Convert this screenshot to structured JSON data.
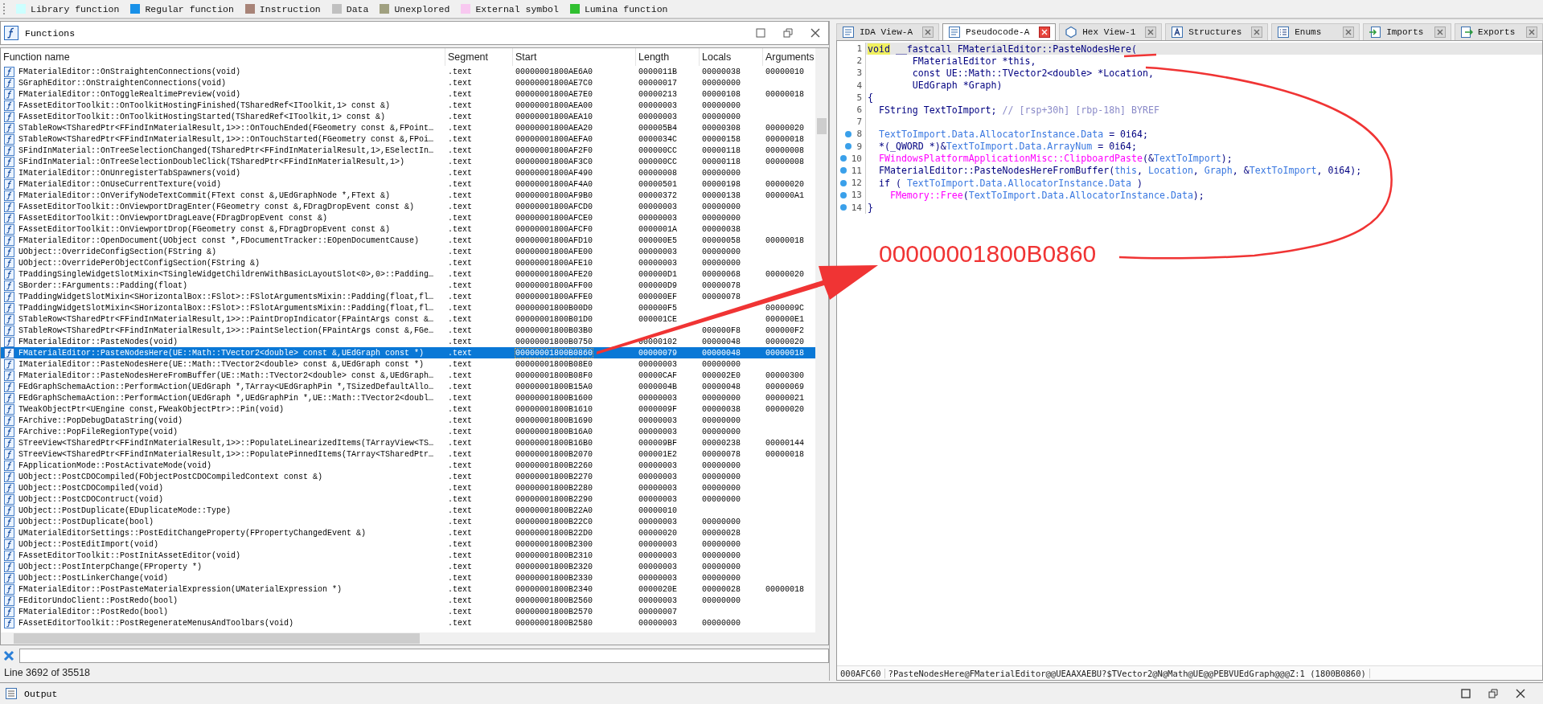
{
  "legend": [
    {
      "label": "Library function",
      "color": "#ccffff"
    },
    {
      "label": "Regular function",
      "color": "#1890e8"
    },
    {
      "label": "Instruction",
      "color": "#a88478"
    },
    {
      "label": "Data",
      "color": "#c0c0c0"
    },
    {
      "label": "Unexplored",
      "color": "#a0a080"
    },
    {
      "label": "External symbol",
      "color": "#f8c8f0"
    },
    {
      "label": "Lumina function",
      "color": "#30c030"
    }
  ],
  "functions_window": {
    "title": "Functions",
    "columns": [
      "Function name",
      "Segment",
      "Start",
      "Length",
      "Locals",
      "Arguments"
    ],
    "rows": [
      {
        "name": "FMaterialEditor::OnStraightenConnections(void)",
        "segment": ".text",
        "start": "00000001800AE6A0",
        "length": "0000011B",
        "locals": "00000038",
        "arguments": "00000010",
        "selected": false
      },
      {
        "name": "SGraphEditor::OnStraightenConnections(void)",
        "segment": ".text",
        "start": "00000001800AE7C0",
        "length": "00000017",
        "locals": "00000000",
        "selected": false
      },
      {
        "name": "FMaterialEditor::OnToggleRealtimePreview(void)",
        "segment": ".text",
        "start": "00000001800AE7E0",
        "length": "00000213",
        "locals": "00000108",
        "arguments": "00000018",
        "selected": false
      },
      {
        "name": "FAssetEditorToolkit::OnToolkitHostingFinished(TSharedRef<IToolkit,1> const &)",
        "segment": ".text",
        "start": "00000001800AEA00",
        "length": "00000003",
        "locals": "00000000",
        "selected": false
      },
      {
        "name": "FAssetEditorToolkit::OnToolkitHostingStarted(TSharedRef<IToolkit,1> const &)",
        "segment": ".text",
        "start": "00000001800AEA10",
        "length": "00000003",
        "locals": "00000000",
        "selected": false
      },
      {
        "name": "STableRow<TSharedPtr<FFindInMaterialResult,1>>::OnTouchEnded(FGeometry const &,FPoint…",
        "segment": ".text",
        "start": "00000001800AEA20",
        "length": "000005B4",
        "locals": "00000308",
        "arguments": "00000020",
        "selected": false
      },
      {
        "name": "STableRow<TSharedPtr<FFindInMaterialResult,1>>::OnTouchStarted(FGeometry const &,FPoi…",
        "segment": ".text",
        "start": "00000001800AEFA0",
        "length": "0000034C",
        "locals": "00000158",
        "arguments": "00000018",
        "selected": false
      },
      {
        "name": "SFindInMaterial::OnTreeSelectionChanged(TSharedPtr<FFindInMaterialResult,1>,ESelectIn…",
        "segment": ".text",
        "start": "00000001800AF2F0",
        "length": "000000CC",
        "locals": "00000118",
        "arguments": "00000008",
        "selected": false
      },
      {
        "name": "SFindInMaterial::OnTreeSelectionDoubleClick(TSharedPtr<FFindInMaterialResult,1>)",
        "segment": ".text",
        "start": "00000001800AF3C0",
        "length": "000000CC",
        "locals": "00000118",
        "arguments": "00000008",
        "selected": false
      },
      {
        "name": "IMaterialEditor::OnUnregisterTabSpawners(void)",
        "segment": ".text",
        "start": "00000001800AF490",
        "length": "00000008",
        "locals": "00000000",
        "selected": false
      },
      {
        "name": "FMaterialEditor::OnUseCurrentTexture(void)",
        "segment": ".text",
        "start": "00000001800AF4A0",
        "length": "00000501",
        "locals": "00000198",
        "arguments": "00000020",
        "selected": false
      },
      {
        "name": "FMaterialEditor::OnVerifyNodeTextCommit(FText const &,UEdGraphNode *,FText &)",
        "segment": ".text",
        "start": "00000001800AF9B0",
        "length": "00000372",
        "locals": "00000138",
        "arguments": "000000A1",
        "selected": false
      },
      {
        "name": "FAssetEditorToolkit::OnViewportDragEnter(FGeometry const &,FDragDropEvent const &)",
        "segment": ".text",
        "start": "00000001800AFCD0",
        "length": "00000003",
        "locals": "00000000",
        "selected": false
      },
      {
        "name": "FAssetEditorToolkit::OnViewportDragLeave(FDragDropEvent const &)",
        "segment": ".text",
        "start": "00000001800AFCE0",
        "length": "00000003",
        "locals": "00000000",
        "selected": false
      },
      {
        "name": "FAssetEditorToolkit::OnViewportDrop(FGeometry const &,FDragDropEvent const &)",
        "segment": ".text",
        "start": "00000001800AFCF0",
        "length": "0000001A",
        "locals": "00000038",
        "selected": false
      },
      {
        "name": "FMaterialEditor::OpenDocument(UObject const *,FDocumentTracker::EOpenDocumentCause)",
        "segment": ".text",
        "start": "00000001800AFD10",
        "length": "000000E5",
        "locals": "00000058",
        "arguments": "00000018",
        "selected": false
      },
      {
        "name": "UObject::OverrideConfigSection(FString &)",
        "segment": ".text",
        "start": "00000001800AFE00",
        "length": "00000003",
        "locals": "00000000",
        "selected": false
      },
      {
        "name": "UObject::OverridePerObjectConfigSection(FString &)",
        "segment": ".text",
        "start": "00000001800AFE10",
        "length": "00000003",
        "locals": "00000000",
        "selected": false
      },
      {
        "name": "TPaddingSingleWidgetSlotMixin<TSingleWidgetChildrenWithBasicLayoutSlot<0>,0>::Padding…",
        "segment": ".text",
        "start": "00000001800AFE20",
        "length": "000000D1",
        "locals": "00000068",
        "arguments": "00000020",
        "selected": false
      },
      {
        "name": "SBorder::FArguments::Padding(float)",
        "segment": ".text",
        "start": "00000001800AFF00",
        "length": "000000D9",
        "locals": "00000078",
        "selected": false
      },
      {
        "name": "TPaddingWidgetSlotMixin<SHorizontalBox::FSlot>::FSlotArgumentsMixin::Padding(float,fl…",
        "segment": ".text",
        "start": "00000001800AFFE0",
        "length": "000000EF",
        "locals": "00000078",
        "selected": false
      },
      {
        "name": "TPaddingWidgetSlotMixin<SHorizontalBox::FSlot>::FSlotArgumentsMixin::Padding(float,fl…",
        "segment": ".text",
        "start": "00000001800B00D0",
        "length": "000000F5",
        "arguments": "0000009C",
        "selected": false
      },
      {
        "name": "STableRow<TSharedPtr<FFindInMaterialResult,1>>::PaintDropIndicator(FPaintArgs const &…",
        "segment": ".text",
        "start": "00000001800B01D0",
        "length": "000001CE",
        "arguments": "000000E1",
        "selected": false
      },
      {
        "name": "STableRow<TSharedPtr<FFindInMaterialResult,1>>::PaintSelection(FPaintArgs const &,FGe…",
        "segment": ".text",
        "start": "00000001800B03B0",
        "locals": "000000F8",
        "arguments": "000000F2",
        "selected": false
      },
      {
        "name": "FMaterialEditor::PasteNodes(void)",
        "segment": ".text",
        "start": "00000001800B0750",
        "length": "00000102",
        "locals": "00000048",
        "arguments": "00000020",
        "selected": false
      },
      {
        "name": "FMaterialEditor::PasteNodesHere(UE::Math::TVector2<double> const &,UEdGraph const *)",
        "segment": ".text",
        "start": "00000001800B0860",
        "length": "00000079",
        "locals": "00000048",
        "arguments": "00000018",
        "selected": true
      },
      {
        "name": "IMaterialEditor::PasteNodesHere(UE::Math::TVector2<double> const &,UEdGraph const *)",
        "segment": ".text",
        "start": "00000001800B08E0",
        "length": "00000003",
        "locals": "00000000",
        "selected": false
      },
      {
        "name": "FMaterialEditor::PasteNodesHereFromBuffer(UE::Math::TVector2<double> const &,UEdGraph…",
        "segment": ".text",
        "start": "00000001800B08F0",
        "length": "00000CAF",
        "locals": "000002E0",
        "arguments": "00000300",
        "selected": false
      },
      {
        "name": "FEdGraphSchemaAction::PerformAction(UEdGraph *,TArray<UEdGraphPin *,TSizedDefaultAllo…",
        "segment": ".text",
        "start": "00000001800B15A0",
        "length": "0000004B",
        "locals": "00000048",
        "arguments": "00000069",
        "selected": false
      },
      {
        "name": "FEdGraphSchemaAction::PerformAction(UEdGraph *,UEdGraphPin *,UE::Math::TVector2<doubl…",
        "segment": ".text",
        "start": "00000001800B1600",
        "length": "00000003",
        "locals": "00000000",
        "arguments": "00000021",
        "selected": false
      },
      {
        "name": "TWeakObjectPtr<UEngine const,FWeakObjectPtr>::Pin(void)",
        "segment": ".text",
        "start": "00000001800B1610",
        "length": "0000009F",
        "locals": "00000038",
        "arguments": "00000020",
        "selected": false
      },
      {
        "name": "FArchive::PopDebugDataString(void)",
        "segment": ".text",
        "start": "00000001800B1690",
        "length": "00000003",
        "locals": "00000000",
        "selected": false
      },
      {
        "name": "FArchive::PopFileRegionType(void)",
        "segment": ".text",
        "start": "00000001800B16A0",
        "length": "00000003",
        "locals": "00000000",
        "selected": false
      },
      {
        "name": "STreeView<TSharedPtr<FFindInMaterialResult,1>>::PopulateLinearizedItems(TArrayView<TS…",
        "segment": ".text",
        "start": "00000001800B16B0",
        "length": "000009BF",
        "locals": "00000238",
        "arguments": "00000144",
        "selected": false
      },
      {
        "name": "STreeView<TSharedPtr<FFindInMaterialResult,1>>::PopulatePinnedItems(TArray<TSharedPtr…",
        "segment": ".text",
        "start": "00000001800B2070",
        "length": "000001E2",
        "locals": "00000078",
        "arguments": "00000018",
        "selected": false
      },
      {
        "name": "FApplicationMode::PostActivateMode(void)",
        "segment": ".text",
        "start": "00000001800B2260",
        "length": "00000003",
        "locals": "00000000",
        "selected": false
      },
      {
        "name": "UObject::PostCDOCompiled(FObjectPostCDOCompiledContext const &)",
        "segment": ".text",
        "start": "00000001800B2270",
        "length": "00000003",
        "locals": "00000000",
        "selected": false
      },
      {
        "name": "UObject::PostCDOCompiled(void)",
        "segment": ".text",
        "start": "00000001800B2280",
        "length": "00000003",
        "locals": "00000000",
        "selected": false
      },
      {
        "name": "UObject::PostCDOContruct(void)",
        "segment": ".text",
        "start": "00000001800B2290",
        "length": "00000003",
        "locals": "00000000",
        "selected": false
      },
      {
        "name": "UObject::PostDuplicate(EDuplicateMode::Type)",
        "segment": ".text",
        "start": "00000001800B22A0",
        "length": "00000010",
        "selected": false
      },
      {
        "name": "UObject::PostDuplicate(bool)",
        "segment": ".text",
        "start": "00000001800B22C0",
        "length": "00000003",
        "locals": "00000000",
        "selected": false
      },
      {
        "name": "UMaterialEditorSettings::PostEditChangeProperty(FPropertyChangedEvent &)",
        "segment": ".text",
        "start": "00000001800B22D0",
        "length": "00000020",
        "locals": "00000028",
        "selected": false
      },
      {
        "name": "UObject::PostEditImport(void)",
        "segment": ".text",
        "start": "00000001800B2300",
        "length": "00000003",
        "locals": "00000000",
        "selected": false
      },
      {
        "name": "FAssetEditorToolkit::PostInitAssetEditor(void)",
        "segment": ".text",
        "start": "00000001800B2310",
        "length": "00000003",
        "locals": "00000000",
        "selected": false
      },
      {
        "name": "UObject::PostInterpChange(FProperty *)",
        "segment": ".text",
        "start": "00000001800B2320",
        "length": "00000003",
        "locals": "00000000",
        "selected": false
      },
      {
        "name": "UObject::PostLinkerChange(void)",
        "segment": ".text",
        "start": "00000001800B2330",
        "length": "00000003",
        "locals": "00000000",
        "selected": false
      },
      {
        "name": "FMaterialEditor::PostPasteMaterialExpression(UMaterialExpression *)",
        "segment": ".text",
        "start": "00000001800B2340",
        "length": "0000020E",
        "locals": "00000028",
        "arguments": "00000018",
        "selected": false
      },
      {
        "name": "FEditorUndoClient::PostRedo(bool)",
        "segment": ".text",
        "start": "00000001800B2560",
        "length": "00000003",
        "locals": "00000000",
        "selected": false
      },
      {
        "name": "FMaterialEditor::PostRedo(bool)",
        "segment": ".text",
        "start": "00000001800B2570",
        "length": "00000007",
        "selected": false
      },
      {
        "name": "FAssetEditorToolkit::PostRegenerateMenusAndToolbars(void)",
        "segment": ".text",
        "start": "00000001800B2580",
        "length": "00000003",
        "locals": "00000000",
        "selected": false
      }
    ],
    "status": "Line 3692 of 35518"
  },
  "tabs": [
    {
      "label": "IDA View-A",
      "kind": "disasm",
      "selected": false
    },
    {
      "label": "Pseudocode-A",
      "kind": "pseudocode",
      "selected": true
    },
    {
      "label": "Hex View-1",
      "kind": "hex",
      "selected": false
    },
    {
      "label": "Structures",
      "kind": "structures",
      "selected": false
    },
    {
      "label": "Enums",
      "kind": "enums",
      "selected": false
    },
    {
      "label": "Imports",
      "kind": "imports",
      "selected": false
    },
    {
      "label": "Exports",
      "kind": "exports",
      "selected": false
    }
  ],
  "code": [
    {
      "number": "1",
      "current": true,
      "breakpoint": false,
      "segments": [
        {
          "text": "void",
          "kind": "match"
        },
        {
          "text": " __fastcall FMaterialEditor::PasteNodesHere(",
          "kind": "plain"
        }
      ]
    },
    {
      "number": "2",
      "current": false,
      "breakpoint": false,
      "segments": [
        {
          "text": "        FMaterialEditor *this,",
          "kind": "plain"
        }
      ]
    },
    {
      "number": "3",
      "current": false,
      "breakpoint": false,
      "segments": [
        {
          "text": "        const UE::Math::TVector2<double> *Location,",
          "kind": "plain"
        }
      ]
    },
    {
      "number": "4",
      "current": false,
      "breakpoint": false,
      "segments": [
        {
          "text": "        UEdGraph *Graph)",
          "kind": "plain"
        }
      ]
    },
    {
      "number": "5",
      "current": false,
      "breakpoint": false,
      "segments": [
        {
          "text": "{",
          "kind": "plain"
        }
      ]
    },
    {
      "number": "6",
      "current": false,
      "breakpoint": false,
      "segments": [
        {
          "text": "  FString TextToImport; ",
          "kind": "plain"
        },
        {
          "text": "// [rsp+30h] [rbp-18h] BYREF",
          "kind": "comment"
        }
      ]
    },
    {
      "number": "7",
      "current": false,
      "breakpoint": false
    },
    {
      "number": "8",
      "current": false,
      "breakpoint": true,
      "segments": [
        {
          "text": "  TextToImport.Data.AllocatorInstance.Data",
          "kind": "var"
        },
        {
          "text": " = 0i64;",
          "kind": "plain"
        }
      ]
    },
    {
      "number": "9",
      "current": false,
      "breakpoint": true,
      "segments": [
        {
          "text": "  *(_QWORD *)&",
          "kind": "plain"
        },
        {
          "text": "TextToImport.Data.ArrayNum",
          "kind": "var"
        },
        {
          "text": " = 0i64;",
          "kind": "plain"
        }
      ]
    },
    {
      "number": "10",
      "current": false,
      "breakpoint": true,
      "segments": [
        {
          "text": "  FWindowsPlatformApplicationMisc::ClipboardPaste",
          "kind": "import"
        },
        {
          "text": "(&",
          "kind": "plain"
        },
        {
          "text": "TextToImport",
          "kind": "var"
        },
        {
          "text": ");",
          "kind": "plain"
        }
      ]
    },
    {
      "number": "11",
      "current": false,
      "breakpoint": true,
      "segments": [
        {
          "text": "  FMaterialEditor::PasteNodesHereFromBuffer(",
          "kind": "plain"
        },
        {
          "text": "this",
          "kind": "var"
        },
        {
          "text": ", ",
          "kind": "plain"
        },
        {
          "text": "Location",
          "kind": "var"
        },
        {
          "text": ", ",
          "kind": "plain"
        },
        {
          "text": "Graph",
          "kind": "var"
        },
        {
          "text": ", &",
          "kind": "plain"
        },
        {
          "text": "TextToImport",
          "kind": "var"
        },
        {
          "text": ", 0i64);",
          "kind": "plain"
        }
      ]
    },
    {
      "number": "12",
      "current": false,
      "breakpoint": true,
      "segments": [
        {
          "text": "  if ( ",
          "kind": "plain"
        },
        {
          "text": "TextToImport.Data.AllocatorInstance.Data",
          "kind": "var"
        },
        {
          "text": " )",
          "kind": "plain"
        }
      ]
    },
    {
      "number": "13",
      "current": false,
      "breakpoint": true,
      "segments": [
        {
          "text": "    FMemory::Free",
          "kind": "import"
        },
        {
          "text": "(",
          "kind": "plain"
        },
        {
          "text": "TextToImport.Data.AllocatorInstance.Data",
          "kind": "var"
        },
        {
          "text": ");",
          "kind": "plain"
        }
      ]
    },
    {
      "number": "14",
      "current": false,
      "breakpoint": true,
      "segments": [
        {
          "text": "}",
          "kind": "plain"
        }
      ]
    }
  ],
  "status_strip": [
    "000AFC60",
    "?PasteNodesHere@FMaterialEditor@@UEAAXAEBU?$TVector2@N@Math@UE@@PEBVUEdGraph@@@Z:1 (1800B0860)"
  ],
  "annotation": {
    "text": "00000001800B0860"
  },
  "output_panel": {
    "title": "Output"
  }
}
